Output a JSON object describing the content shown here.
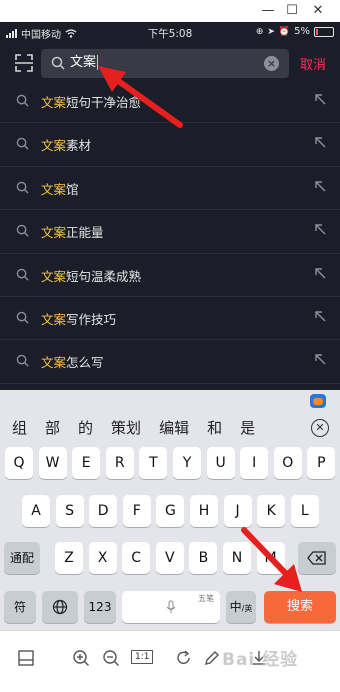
{
  "window": {
    "minimize": "—",
    "maximize": "☐",
    "close": "✕"
  },
  "status": {
    "carrier": "中国移动",
    "time": "下午5:08",
    "battery": "5%"
  },
  "search": {
    "query": "文案",
    "cancel": "取消"
  },
  "suggestions": [
    {
      "highlight": "文案",
      "rest": "短句干净治愈"
    },
    {
      "highlight": "文案",
      "rest": "素材"
    },
    {
      "highlight": "文案",
      "rest": "馆"
    },
    {
      "highlight": "文案",
      "rest": "正能量"
    },
    {
      "highlight": "文案",
      "rest": "短句温柔成熟"
    },
    {
      "highlight": "文案",
      "rest": "写作技巧"
    },
    {
      "highlight": "文案",
      "rest": "怎么写"
    }
  ],
  "keyboard": {
    "candidates": [
      "组",
      "部",
      "的",
      "策划",
      "编辑",
      "和",
      "是"
    ],
    "row1": [
      "Q",
      "W",
      "E",
      "R",
      "T",
      "Y",
      "U",
      "I",
      "O",
      "P"
    ],
    "row2": [
      "A",
      "S",
      "D",
      "F",
      "G",
      "H",
      "J",
      "K",
      "L"
    ],
    "row3_left": "通配",
    "row3": [
      "Z",
      "X",
      "C",
      "V",
      "B",
      "N",
      "M"
    ],
    "fu": "符",
    "num": "123",
    "space_badge": "五笔",
    "lang_main": "中",
    "lang_sub": "/英",
    "search_key": "搜索"
  },
  "toolbar": {
    "zoom_label": "1:1",
    "watermark": "Bai 经验"
  },
  "colors": {
    "accent_red": "#fe2c55",
    "highlight": "#f7c744",
    "arrow": "#e5201e",
    "key_orange": "#f7683a"
  }
}
